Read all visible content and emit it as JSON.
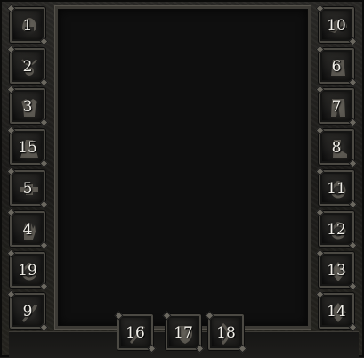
{
  "left_slots": [
    {
      "label": "1",
      "icon": "helmet-icon"
    },
    {
      "label": "2",
      "icon": "amulet-icon"
    },
    {
      "label": "3",
      "icon": "armor-icon"
    },
    {
      "label": "15",
      "icon": "cloak-icon"
    },
    {
      "label": "5",
      "icon": "belt-icon"
    },
    {
      "label": "4",
      "icon": "gloves-icon"
    },
    {
      "label": "19",
      "icon": "ring-icon"
    },
    {
      "label": "9",
      "icon": "weapon-icon"
    }
  ],
  "right_slots": [
    {
      "label": "10",
      "icon": "shoulder-icon"
    },
    {
      "label": "6",
      "icon": "bracer-icon"
    },
    {
      "label": "7",
      "icon": "legs-icon"
    },
    {
      "label": "8",
      "icon": "boots-icon"
    },
    {
      "label": "11",
      "icon": "ring-icon"
    },
    {
      "label": "12",
      "icon": "ring-icon"
    },
    {
      "label": "13",
      "icon": "trinket-icon"
    },
    {
      "label": "14",
      "icon": "trinket-icon"
    }
  ],
  "bottom_slots": [
    {
      "label": "16",
      "icon": "main-hand-icon"
    },
    {
      "label": "17",
      "icon": "off-hand-icon"
    },
    {
      "label": "18",
      "icon": "ranged-icon"
    }
  ]
}
